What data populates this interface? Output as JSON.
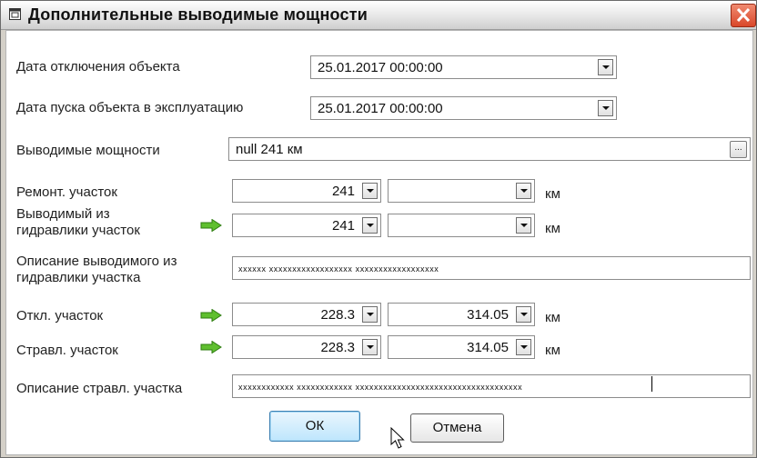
{
  "window": {
    "title": "Дополнительные выводимые мощности"
  },
  "fields": {
    "shutdown_date": {
      "label": "Дата отключения объекта",
      "value": "25.01.2017 00:00:00"
    },
    "commission_date": {
      "label": "Дата пуска объекта в эксплуатацию",
      "value": "25.01.2017 00:00:00"
    },
    "output_capacity": {
      "label": "Выводимые мощности",
      "value": "null 241 км",
      "button_label": "..."
    },
    "repair_section": {
      "label": "Ремонт. участок",
      "from": "241",
      "to": "",
      "unit": "км"
    },
    "hydraulics_section": {
      "label_line1": "Выводимый из",
      "label_line2": "гидравлики участок",
      "from": "241",
      "to": "",
      "unit": "км"
    },
    "hydraulics_description": {
      "label_line1": "Описание выводимого из",
      "label_line2": "гидравлики участка",
      "value": "xxxxxx xxxxxxxxxxxxxxxxxx xxxxxxxxxxxxxxxxxx"
    },
    "disconnected_section": {
      "label": "Откл. участок",
      "from": "228.3",
      "to": "314.05",
      "unit": "км"
    },
    "drained_section": {
      "label": "Стравл. участок",
      "from": "228.3",
      "to": "314.05",
      "unit": "км"
    },
    "drained_description": {
      "label": "Описание стравл. участка",
      "value": "xxxxxxxxxxxx  xxxxxxxxxxxx  xxxxxxxxxxxxxxxxxxxxxxxxxxxxxxxxxxxx"
    }
  },
  "buttons": {
    "ok": "ОК",
    "cancel": "Отмена"
  },
  "icons": {
    "window": "window-icon",
    "close": "close-icon",
    "arrow": "green-arrow-icon",
    "dropdown": "dropdown-arrow-icon",
    "cursor": "mouse-cursor-icon"
  },
  "colors": {
    "close_button": "#d9472a",
    "arrow": "#5fbf2f",
    "ok_button": "#bee6fd"
  }
}
